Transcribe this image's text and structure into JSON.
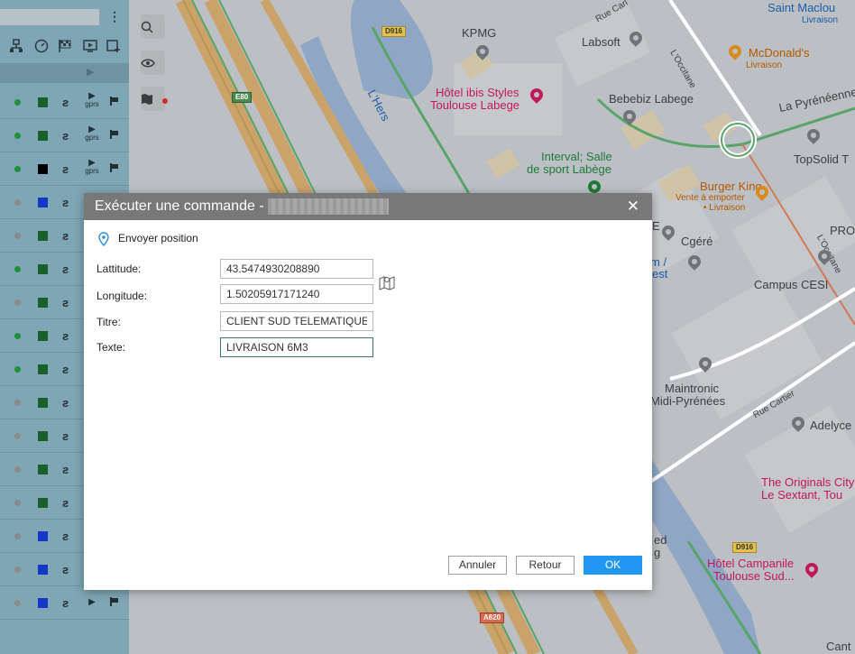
{
  "left_panel": {
    "toolbar_icons": [
      "network-icon",
      "speedometer-icon",
      "checkered-flag-icon",
      "monitor-play-icon",
      "add-window-icon"
    ],
    "header_play": "▶",
    "rows": [
      {
        "status_color": "#1f8f3a",
        "square_color": "#1a5e2a",
        "mode": "gprs",
        "flag": true
      },
      {
        "status_color": "#1f8f3a",
        "square_color": "#1a5e2a",
        "mode": "gprs",
        "flag": true
      },
      {
        "status_color": "#1f8f3a",
        "square_color": "#000000",
        "mode": "gprs",
        "flag": true
      },
      {
        "status_color": "#8a8a8a",
        "square_color": "#1437c8",
        "mode": "",
        "flag": false
      },
      {
        "status_color": "#8a8a8a",
        "square_color": "#1a5e2a",
        "mode": "",
        "flag": false
      },
      {
        "status_color": "#1f8f3a",
        "square_color": "#1a5e2a",
        "mode": "",
        "flag": false
      },
      {
        "status_color": "#8a8a8a",
        "square_color": "#1a5e2a",
        "mode": "",
        "flag": false
      },
      {
        "status_color": "#1f8f3a",
        "square_color": "#1a5e2a",
        "mode": "",
        "flag": false
      },
      {
        "status_color": "#1f8f3a",
        "square_color": "#1a5e2a",
        "mode": "",
        "flag": false
      },
      {
        "status_color": "#8a8a8a",
        "square_color": "#1a5e2a",
        "mode": "",
        "flag": false
      },
      {
        "status_color": "#8a8a8a",
        "square_color": "#1a5e2a",
        "mode": "",
        "flag": false
      },
      {
        "status_color": "#8a8a8a",
        "square_color": "#1a5e2a",
        "mode": "",
        "flag": false
      },
      {
        "status_color": "#8a8a8a",
        "square_color": "#1a5e2a",
        "mode": "",
        "flag": false
      },
      {
        "status_color": "#8a8a8a",
        "square_color": "#1437c8",
        "mode": "",
        "flag": false
      },
      {
        "status_color": "#8a8a8a",
        "square_color": "#1437c8",
        "mode": "play",
        "flag": true
      },
      {
        "status_color": "#8a8a8a",
        "square_color": "#1437c8",
        "mode": "play",
        "flag": true
      }
    ],
    "mode_gprs_label": "gprs",
    "signal_glyph": "ƨ",
    "play_glyph": "▶"
  },
  "map": {
    "tool_icons": [
      "search-icon",
      "eye-icon",
      "map-layers-icon"
    ],
    "labels": {
      "saint_maclou": "Saint Maclou",
      "livraison_1": "Livraison",
      "rue_carl": "Rue Carl",
      "kpmg": "KPMG",
      "labsoft": "Labsoft",
      "loccitane_1": "L'Occitane",
      "mcdonalds": "McDonald's",
      "livraison_2": "Livraison",
      "lhers": "L'Hers",
      "hotel_ibis_1": "Hôtel ibis Styles",
      "hotel_ibis_2": "Toulouse Labege",
      "bebebiz": "Bebebiz Labege",
      "la_pyreneenne": "La Pyrénéenne",
      "interval_1": "Interval; Salle",
      "interval_2": "de sport Labège",
      "topsolid": "TopSolid T",
      "burger_king": "Burger King",
      "vente_emporter": "Vente à emporter",
      "livraison_3": "• Livraison",
      "pro": "PRO",
      "cgere": "Cgéré",
      "loccitane_2": "L'Occitane",
      "campus_cesi": "Campus CESI",
      "m_est_1": "m /",
      "m_est_2": "est",
      "maintronic_1": "Maintronic",
      "maintronic_2": "Midi-Pyrénées",
      "rue_cartier": "Rue Cartier",
      "adelyce": "Adelyce",
      "originals_1": "The Originals City",
      "originals_2": "Le Sextant, Tou",
      "ed": "ed",
      "g": "g",
      "campanile_1": "Hôtel Campanile",
      "campanile_2": "Toulouse Sud...",
      "cant": "Cant",
      "d916_a": "D916",
      "d916_b": "D916",
      "a620": "A620",
      "e80": "E80",
      "e_frag": "E"
    }
  },
  "dialog": {
    "title": "Exécuter une commande -",
    "close": "✕",
    "command_name": "Envoyer position",
    "fields": {
      "latitude_label": "Lattitude:",
      "latitude_value": "43.5474930208890",
      "longitude_label": "Longitude:",
      "longitude_value": "1.50205917171240",
      "title_label": "Titre:",
      "title_value": "CLIENT SUD TELEMATIQUE",
      "text_label": "Texte:",
      "text_value": "LIVRAISON 6M3"
    },
    "buttons": {
      "cancel": "Annuler",
      "back": "Retour",
      "ok": "OK"
    },
    "colors": {
      "titlebar": "#787878",
      "primary": "#2196f3"
    }
  }
}
